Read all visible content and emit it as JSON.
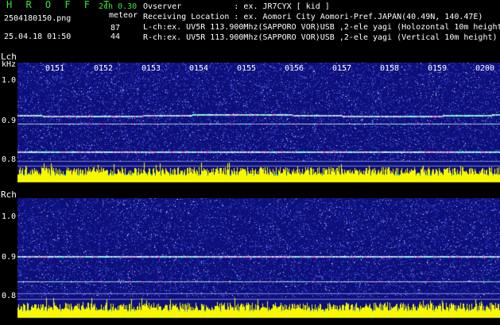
{
  "brand": "H R O F F T",
  "mode": "2ch 0.30",
  "file": "2504180150.png",
  "counter_label": "meteor",
  "counts": [
    "87",
    "44"
  ],
  "timestamp": "25.04.18 01:50",
  "header_lines": [
    "Ovserver           : ex. JR7CYX [ kid ]",
    "Receiving Location : ex. Aomori City Aomori-Pref.JAPAN(40.49N, 140.47E)",
    "L-ch:ex. UV5R 113.900Mhz(SAPPORO VOR)USB ,2-ele yagi (Holozontal 10m height)",
    "R-ch:ex. UV5R 113.900Mhz(SAPPORO VOR)USB ,2-ele yagi (Vertical 10m height)"
  ],
  "panels": [
    {
      "channel": "Lch",
      "unit": "kHz",
      "yticks": [
        "1.0",
        "0.9",
        "0.8"
      ],
      "xticks": [
        "0151",
        "0152",
        "0153",
        "0154",
        "0155",
        "0156",
        "0157",
        "0158",
        "0159",
        "0200"
      ]
    },
    {
      "channel": "Rch",
      "yticks": [
        "1.0",
        "0.9",
        "0.8"
      ]
    }
  ],
  "colors": {
    "brand": "#3ee03e",
    "background": "#000000",
    "noise": "#1a1fa8",
    "level": "#f8f800",
    "floor": "#00b8e0"
  }
}
